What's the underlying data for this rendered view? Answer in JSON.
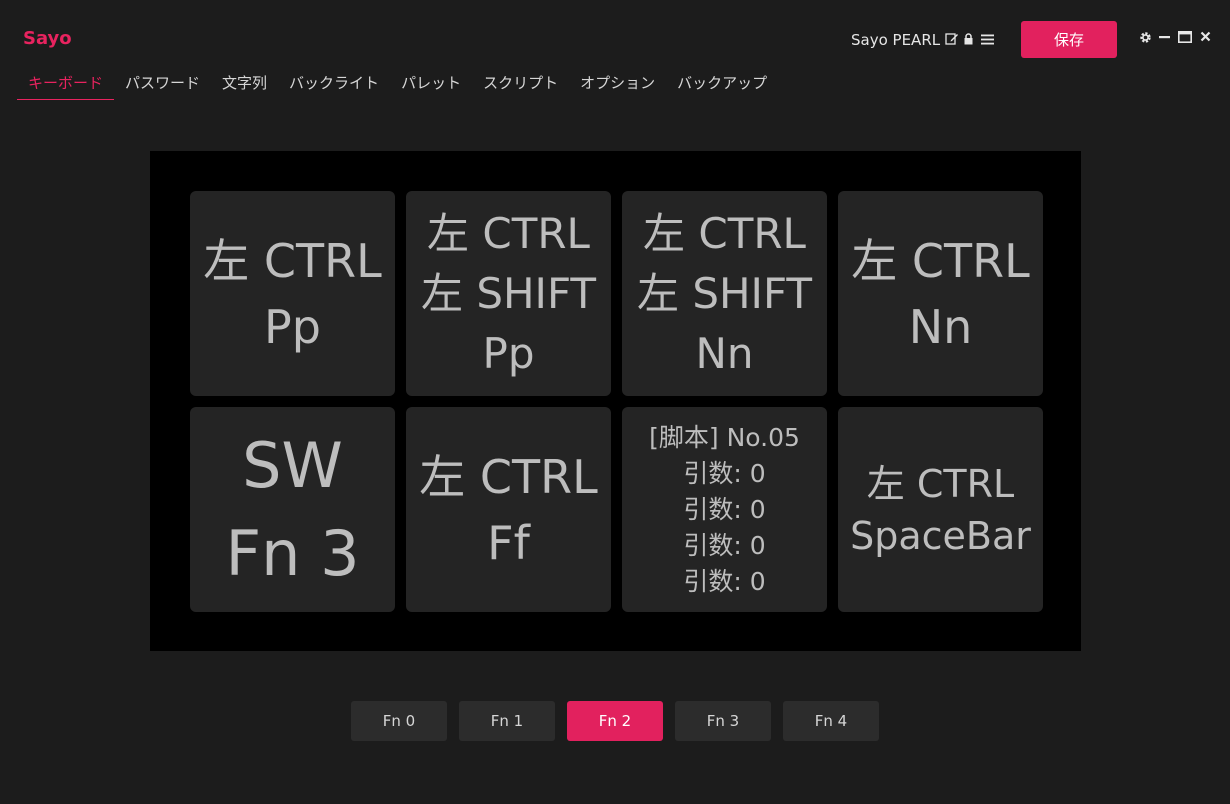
{
  "app": {
    "brand": "Sayo"
  },
  "header": {
    "device_name": "Sayo PEARL",
    "save_label": "保存",
    "icons": [
      "edit-icon",
      "lock-icon",
      "menu-icon",
      "gear-icon",
      "minimize-icon",
      "maximize-icon",
      "close-icon"
    ]
  },
  "tabs": [
    {
      "label": "キーボード",
      "active": true
    },
    {
      "label": "パスワード"
    },
    {
      "label": "文字列"
    },
    {
      "label": "バックライト"
    },
    {
      "label": "パレット"
    },
    {
      "label": "スクリプト"
    },
    {
      "label": "オプション"
    },
    {
      "label": "バックアップ"
    }
  ],
  "keys": [
    {
      "lines": [
        "左 CTRL",
        "Pp"
      ]
    },
    {
      "lines": [
        "左 CTRL",
        "左 SHIFT",
        "Pp"
      ]
    },
    {
      "lines": [
        "左 CTRL",
        "左 SHIFT",
        "Nn"
      ]
    },
    {
      "lines": [
        "左 CTRL",
        "Nn"
      ]
    },
    {
      "lines": [
        "SW",
        "Fn 3"
      ]
    },
    {
      "lines": [
        "左 CTRL",
        "Ff"
      ]
    },
    {
      "lines": [
        "[脚本] No.05",
        "引数: 0",
        "引数: 0",
        "引数: 0",
        "引数: 0"
      ]
    },
    {
      "lines": [
        "左 CTRL",
        "SpaceBar"
      ]
    }
  ],
  "fn_layers": [
    {
      "label": "Fn 0"
    },
    {
      "label": "Fn 1"
    },
    {
      "label": "Fn 2",
      "active": true
    },
    {
      "label": "Fn 3"
    },
    {
      "label": "Fn 4"
    }
  ],
  "colors": {
    "accent": "#e2215e",
    "background": "#1c1c1c",
    "key": "#242424",
    "pad": "#000000"
  }
}
